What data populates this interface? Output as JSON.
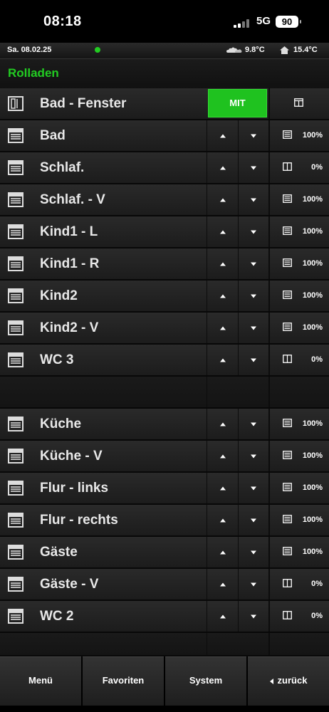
{
  "status": {
    "time": "08:18",
    "network": "5G",
    "battery": "90"
  },
  "info": {
    "date": "Sa. 08.02.25",
    "outdoor_temp": "9.8°C",
    "indoor_temp": "15.4°C"
  },
  "page": {
    "title": "Rolladen"
  },
  "header_row": {
    "name": "Bad - Fenster",
    "mit_label": "MIT",
    "icon": "window-icon"
  },
  "group1": [
    {
      "name": "Bad",
      "percent": "100%",
      "state_icon": "shutter-closed-icon"
    },
    {
      "name": "Schlaf.",
      "percent": "0%",
      "state_icon": "shutter-open-icon"
    },
    {
      "name": "Schlaf. - V",
      "percent": "100%",
      "state_icon": "shutter-closed-icon"
    },
    {
      "name": "Kind1 - L",
      "percent": "100%",
      "state_icon": "shutter-closed-icon"
    },
    {
      "name": "Kind1 - R",
      "percent": "100%",
      "state_icon": "shutter-closed-icon"
    },
    {
      "name": "Kind2",
      "percent": "100%",
      "state_icon": "shutter-closed-icon"
    },
    {
      "name": "Kind2 - V",
      "percent": "100%",
      "state_icon": "shutter-closed-icon"
    },
    {
      "name": "WC 3",
      "percent": "0%",
      "state_icon": "shutter-open-icon"
    }
  ],
  "group2": [
    {
      "name": "Küche",
      "percent": "100%",
      "state_icon": "shutter-closed-icon"
    },
    {
      "name": "Küche - V",
      "percent": "100%",
      "state_icon": "shutter-closed-icon"
    },
    {
      "name": "Flur - links",
      "percent": "100%",
      "state_icon": "shutter-closed-icon"
    },
    {
      "name": "Flur - rechts",
      "percent": "100%",
      "state_icon": "shutter-closed-icon"
    },
    {
      "name": "Gäste",
      "percent": "100%",
      "state_icon": "shutter-closed-icon"
    },
    {
      "name": "Gäste - V",
      "percent": "0%",
      "state_icon": "shutter-open-icon"
    },
    {
      "name": "WC 2",
      "percent": "0%",
      "state_icon": "shutter-open-icon"
    }
  ],
  "bottom_nav": {
    "menu": "Menü",
    "favorites": "Favoriten",
    "system": "System",
    "back": "zurück"
  },
  "colors": {
    "accent": "#22cc22",
    "button_green": "#1fc21f",
    "row_bg": "#222222"
  }
}
